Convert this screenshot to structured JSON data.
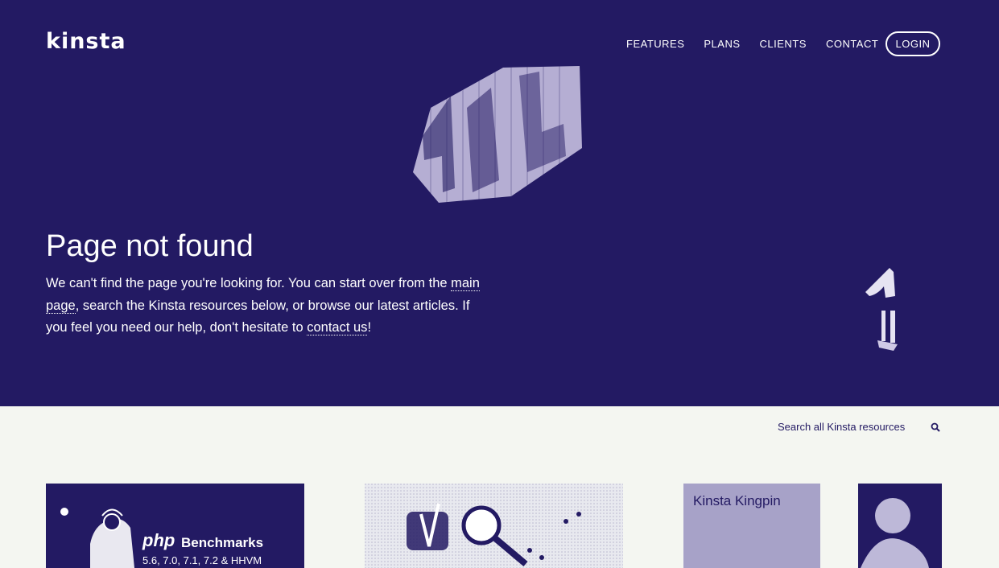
{
  "header": {
    "logo_text": "kinsta",
    "nav": [
      "FEATURES",
      "PLANS",
      "CLIENTS",
      "CONTACT"
    ],
    "login_label": "LOGIN"
  },
  "hero": {
    "title": "Page not found",
    "desc_part1": "We can't find the page you're looking for. You can start over from the ",
    "main_page_link": "main page",
    "desc_part2": ", search the Kinsta resources below, or browse our latest articles. If you feel you need our help, don't hesitate to ",
    "contact_link": "contact us",
    "desc_part3": "!"
  },
  "search": {
    "placeholder": "Search all Kinsta resources",
    "icon": "search-icon"
  },
  "cards": [
    {
      "php_word": "php",
      "bench_word": "Benchmarks",
      "versions": "5.6, 7.0, 7.1, 7.2 & HHVM"
    },
    {
      "icon": "yoast-magnifier-illustration"
    },
    {
      "title": "Kinsta Kingpin"
    }
  ],
  "colors": {
    "primary": "#231a63",
    "background": "#f4f6f1",
    "text_on_primary": "#ffffff"
  }
}
